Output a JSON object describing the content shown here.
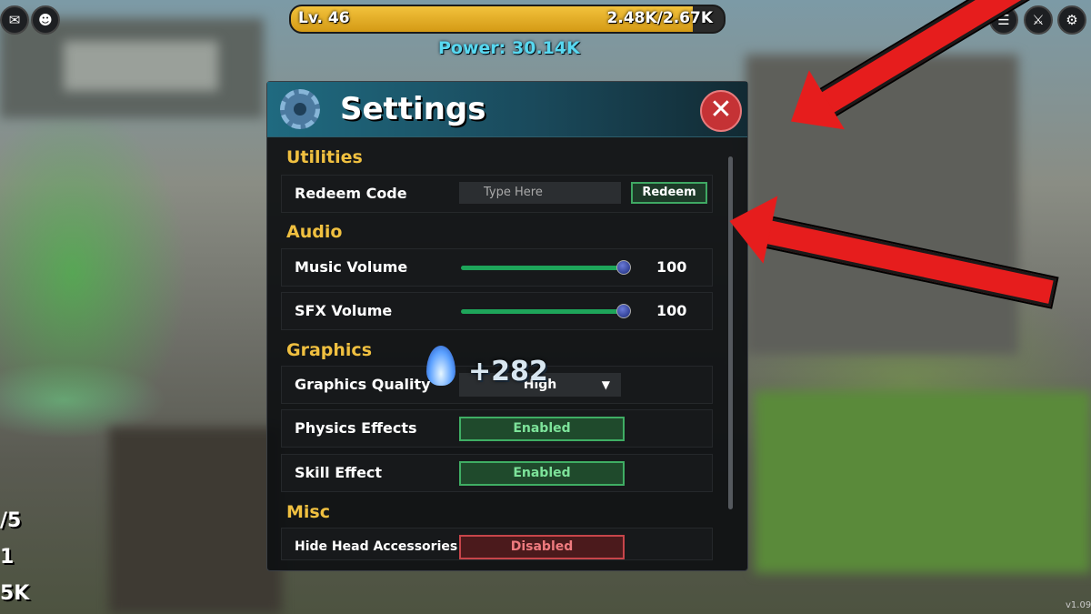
{
  "hud": {
    "level": "Lv. 46",
    "xp": "2.48K/2.67K",
    "xp_progress": 0.929,
    "power": "Power: 30.14K",
    "left_stats": [
      "/5",
      "1",
      "5K"
    ],
    "icons": [
      "mail-icon",
      "avatar-icon",
      "notes-icon",
      "crossed-swords-icon",
      "gear-icon"
    ]
  },
  "settings": {
    "title": "Settings",
    "sections": {
      "utilities": "Utilities",
      "audio": "Audio",
      "graphics": "Graphics",
      "misc": "Misc"
    },
    "redeem_code": {
      "label": "Redeem Code",
      "placeholder": "Type Here",
      "button": "Redeem"
    },
    "music_volume": {
      "label": "Music Volume",
      "value": "100",
      "level": 1.0
    },
    "sfx_volume": {
      "label": "SFX Volume",
      "value": "100",
      "level": 1.0
    },
    "graphics_quality": {
      "label": "Graphics Quality",
      "value": "High"
    },
    "physics_effects": {
      "label": "Physics Effects",
      "value": "Enabled"
    },
    "skill_effect": {
      "label": "Skill Effect",
      "value": "Enabled"
    },
    "hide_head_accessories": {
      "label": "Hide Head Accessories",
      "value": "Disabled"
    }
  },
  "popup": {
    "text": "+282"
  },
  "watermark": "v1.09",
  "colors": {
    "accent_gold": "#f0c040",
    "enabled_green": "#3fae64",
    "disabled_red": "#c7454a",
    "arrow_red": "#e61d1d"
  }
}
